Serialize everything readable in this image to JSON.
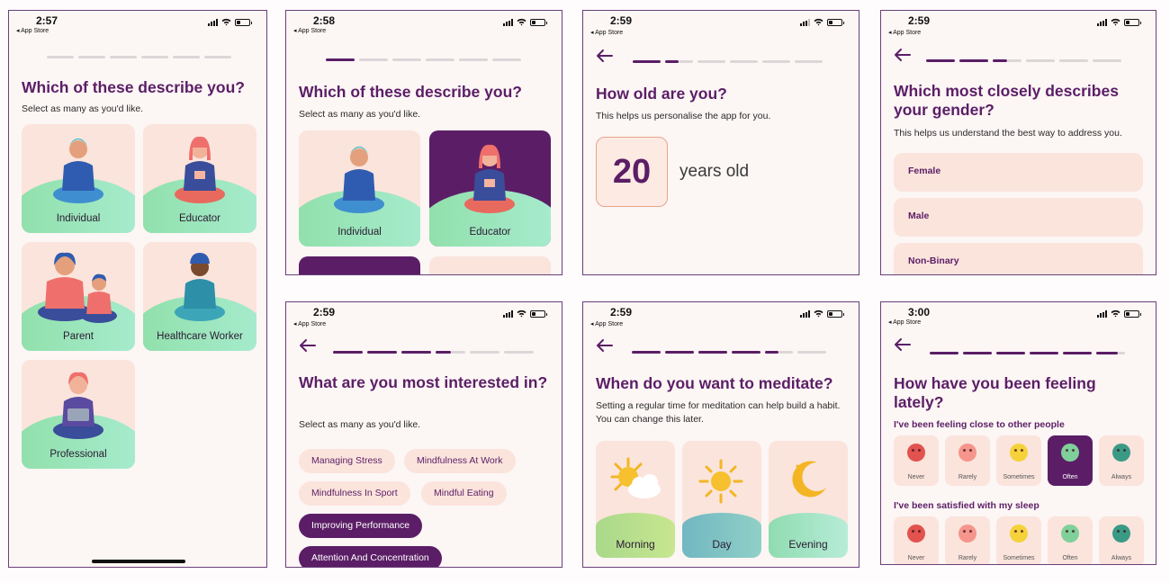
{
  "status_back_label": "◂ App Store",
  "screens": [
    {
      "time": "2:57"
    },
    {
      "time": "2:58"
    },
    {
      "time": "2:59"
    },
    {
      "time": "2:59"
    },
    {
      "time": "2:59"
    },
    {
      "time": "2:59"
    },
    {
      "time": "3:00"
    }
  ],
  "progress_fraction": [
    0.0,
    0.06,
    0.27,
    0.37,
    0.62,
    0.79,
    0.93
  ],
  "describe": {
    "title": "Which of these describe you?",
    "subtitle": "Select as many as you'd like.",
    "options": [
      "Individual",
      "Educator",
      "Parent",
      "Healthcare Worker",
      "Professional"
    ],
    "selected": "Educator"
  },
  "age": {
    "title": "How old are you?",
    "subtitle": "This helps us personalise the app for you.",
    "value": "20",
    "unit": "years old"
  },
  "gender": {
    "title": "Which most closely describes your gender?",
    "subtitle": "This helps us understand the best way to address you.",
    "options": [
      "Female",
      "Male",
      "Non-Binary"
    ]
  },
  "interests": {
    "title": "What are you most interested in?",
    "subtitle": "Select as many as you'd like.",
    "chips": [
      "Managing Stress",
      "Mindfulness At Work",
      "Mindfulness In Sport",
      "Mindful Eating",
      "Improving Performance",
      "Attention And Concentration"
    ],
    "selected": [
      "Improving Performance",
      "Attention And Concentration"
    ]
  },
  "meditate": {
    "title": "When do you want to meditate?",
    "subtitle": "Setting a regular time for meditation can help build a habit. You can change this later.",
    "times": [
      "Morning",
      "Day",
      "Evening"
    ]
  },
  "feeling": {
    "title": "How have you been feeling lately?",
    "q1": "I've been feeling close to other people",
    "q2": "I've been satisfied with my sleep",
    "scale": [
      "Never",
      "Rarely",
      "Sometimes",
      "Often",
      "Always"
    ],
    "q1_selected": "Often"
  },
  "colors": {
    "primary": "#5b1e66",
    "card": "#fbe4dc",
    "bg": "#fcf6f5"
  }
}
